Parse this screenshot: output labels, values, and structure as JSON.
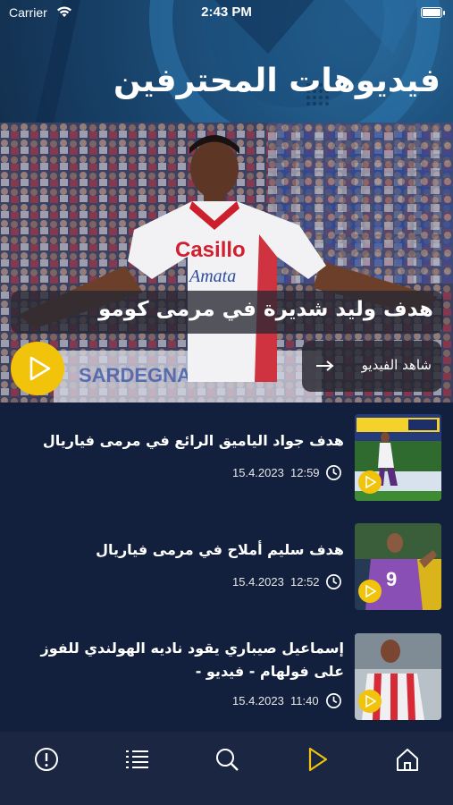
{
  "status_bar": {
    "carrier": "Carrier",
    "time": "2:43 PM"
  },
  "header": {
    "title": "فيديوهات المحترفين"
  },
  "hero": {
    "title": "هدف وليد شديرة في مرمى كومو",
    "watch_label": "شاهد الفيديو",
    "jersey_sponsor": "Casillo",
    "jersey_sub_sponsor": "Amata"
  },
  "videos": [
    {
      "title": "هدف جواد الياميق الرائع في مرمى فياريال",
      "time": "12:59",
      "date": "15.4.2023"
    },
    {
      "title": "هدف سليم أملاح في مرمى فياريال",
      "time": "12:52",
      "date": "15.4.2023"
    },
    {
      "title": "إسماعيل صيباري يقود ناديه الهولندي للفوز على فولهام - فيديو -",
      "time": "11:40",
      "date": "15.4.2023"
    }
  ],
  "tabbar": {
    "items": [
      "info-icon",
      "list-icon",
      "search-icon",
      "play-icon",
      "home-icon"
    ],
    "active": "play-icon",
    "active_color": "#f1c30a"
  },
  "colors": {
    "accent": "#f1c30a",
    "background": "#13203d"
  }
}
